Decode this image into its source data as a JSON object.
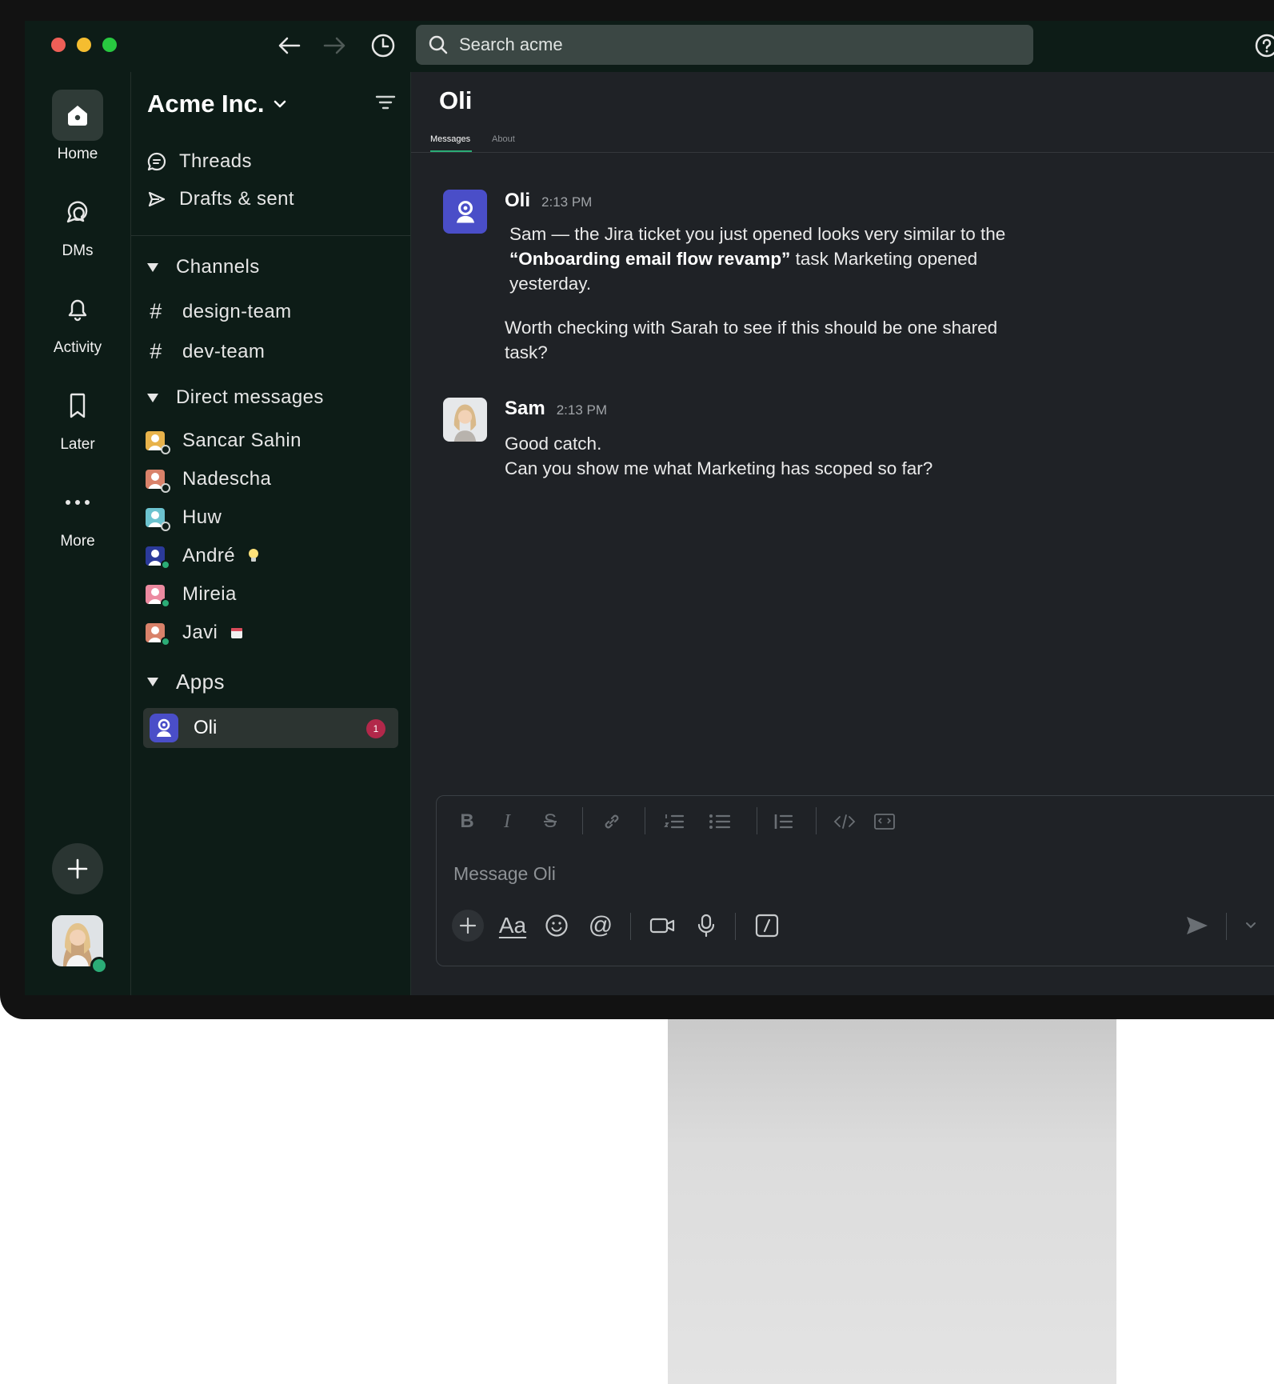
{
  "search": {
    "placeholder": "Search acme"
  },
  "rail": {
    "items": [
      {
        "label": "Home",
        "icon": "home-icon"
      },
      {
        "label": "DMs",
        "icon": "dms-icon"
      },
      {
        "label": "Activity",
        "icon": "bell-icon"
      },
      {
        "label": "Later",
        "icon": "bookmark-icon"
      },
      {
        "label": "More",
        "icon": "more-icon"
      }
    ]
  },
  "sidebar": {
    "workspace": "Acme Inc.",
    "nav": [
      {
        "label": "Threads",
        "icon": "threads-icon"
      },
      {
        "label": "Drafts & sent",
        "icon": "send-icon"
      }
    ],
    "sections": {
      "channels": "Channels",
      "direct_messages": "Direct messages",
      "apps": "Apps"
    },
    "channels": [
      "design-team",
      "dev-team"
    ],
    "dms": [
      {
        "name": "Sancar Sahin",
        "avatar_color": "#e8b34b",
        "status": "away"
      },
      {
        "name": "Nadescha",
        "avatar_color": "#d9826a",
        "status": "away"
      },
      {
        "name": "Huw",
        "avatar_color": "#6cc3cf",
        "status": "away"
      },
      {
        "name": "André",
        "avatar_color": "#2b3a9a",
        "status": "online",
        "emoji": "lightbulb-icon"
      },
      {
        "name": "Mireia",
        "avatar_color": "#ec8aa0",
        "status": "online"
      },
      {
        "name": "Javi",
        "avatar_color": "#d9826a",
        "status": "online",
        "emoji": "calendar-icon"
      }
    ],
    "apps": [
      {
        "name": "Oli",
        "badge": "1"
      }
    ]
  },
  "main": {
    "title": "Oli",
    "tabs": [
      {
        "label": "Messages",
        "active": true
      },
      {
        "label": "About",
        "active": false
      }
    ],
    "messages": [
      {
        "author": "Oli",
        "time": "2:13 PM",
        "p1_a": "Sam — the Jira ticket you just opened looks very similar to the",
        "p1_bold": "“Onboarding email flow revamp”",
        "p1_b": " task Marketing opened",
        "p1_c": "yesterday.",
        "p2_a": "Worth checking with Sarah to see if this should be one shared",
        "p2_b": "task?"
      },
      {
        "author": "Sam",
        "time": "2:13 PM",
        "line1": "Good catch.",
        "line2": "Can you show me what Marketing has scoped so far?"
      }
    ],
    "composer": {
      "placeholder": "Message Oli"
    }
  },
  "colors": {
    "sidebar_bg": "#0d1c17",
    "main_bg": "#1f2226",
    "accent": "#2bac76",
    "badge": "#b2284a",
    "app_avatar": "#4a4ec8"
  }
}
